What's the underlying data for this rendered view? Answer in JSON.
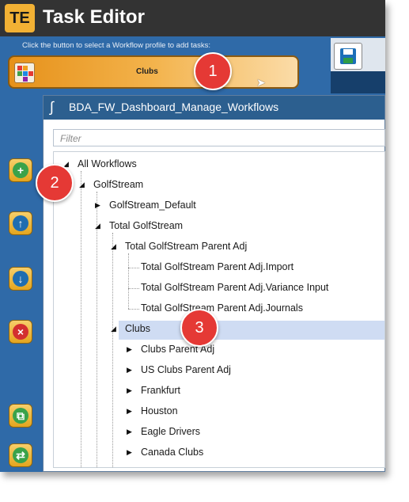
{
  "app": {
    "logo": "TE",
    "title": "Task Editor"
  },
  "hint": "Click the button to select a Workflow profile to add tasks:",
  "profile_button": {
    "label": "Clubs"
  },
  "dialog": {
    "title": "BDA_FW_Dashboard_Manage_Workflows",
    "filter_placeholder": "Filter"
  },
  "tree": {
    "items": [
      {
        "label": "All Workflows"
      },
      {
        "label": "GolfStream"
      },
      {
        "label": "GolfStream_Default"
      },
      {
        "label": "Total GolfStream"
      },
      {
        "label": "Total GolfStream Parent Adj"
      },
      {
        "label": "Total GolfStream Parent Adj.Import"
      },
      {
        "label": "Total GolfStream Parent Adj.Variance Input"
      },
      {
        "label": "Total GolfStream Parent Adj.Journals"
      },
      {
        "label": "Clubs"
      },
      {
        "label": "Clubs Parent Adj"
      },
      {
        "label": "US Clubs Parent Adj"
      },
      {
        "label": "Frankfurt"
      },
      {
        "label": "Houston"
      },
      {
        "label": "Eagle Drivers"
      },
      {
        "label": "Canada Clubs"
      }
    ]
  },
  "badges": [
    "1",
    "2",
    "3"
  ],
  "colors": {
    "accent": "#f2b134",
    "selection": "#cfdcf3",
    "badge": "#e53935",
    "titlebar": "#333333"
  },
  "icons": {
    "add": "plus-circle-icon",
    "up": "arrow-up-icon",
    "down": "arrow-down-icon",
    "delete": "close-circle-icon",
    "copy": "copy-icon",
    "refresh": "refresh-icon",
    "save": "save-icon"
  }
}
